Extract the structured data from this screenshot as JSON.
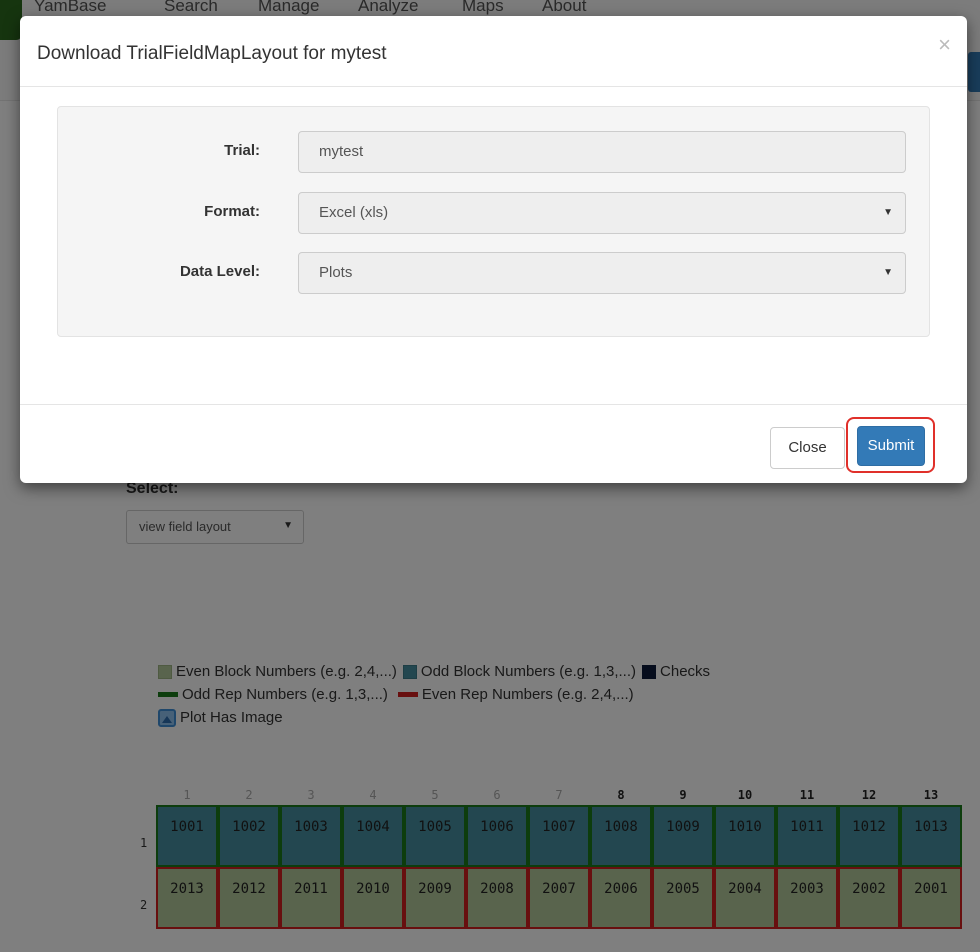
{
  "navbar": {
    "items": [
      "YamBase",
      "Search",
      "Manage",
      "Analyze",
      "Maps",
      "About"
    ]
  },
  "page": {
    "select_label": "Select:",
    "layout_select_value": "view field layout",
    "legend": {
      "even_block": "Even Block Numbers (e.g. 2,4,...)",
      "odd_block": "Odd Block Numbers (e.g. 1,3,...)",
      "checks": "Checks",
      "odd_rep": "Odd Rep Numbers (e.g. 1,3,...)",
      "even_rep": "Even Rep Numbers (e.g. 2,4,...)",
      "plot_image": "Plot Has Image"
    },
    "field_map": {
      "columns": [
        "1",
        "2",
        "3",
        "4",
        "5",
        "6",
        "7",
        "8",
        "9",
        "10",
        "11",
        "12",
        "13"
      ],
      "rows": [
        "1",
        "2"
      ],
      "row1_plots": [
        "1001",
        "1002",
        "1003",
        "1004",
        "1005",
        "1006",
        "1007",
        "1008",
        "1009",
        "1010",
        "1011",
        "1012",
        "1013"
      ],
      "row2_plots": [
        "2013",
        "2012",
        "2011",
        "2010",
        "2009",
        "2008",
        "2007",
        "2006",
        "2005",
        "2004",
        "2003",
        "2002",
        "2001"
      ]
    },
    "colors": {
      "odd_block": "#468fa0",
      "even_block": "#b3c99a",
      "checks": "#0c1a3a",
      "odd_rep": "#1a7a1a",
      "even_rep": "#d11f1f"
    }
  },
  "modal": {
    "title": "Download TrialFieldMapLayout for mytest",
    "close_icon": "×",
    "fields": {
      "trial_label": "Trial:",
      "trial_value": "mytest",
      "format_label": "Format:",
      "format_value": "Excel (xls)",
      "data_level_label": "Data Level:",
      "data_level_value": "Plots"
    },
    "close_label": "Close",
    "submit_label": "Submit"
  }
}
